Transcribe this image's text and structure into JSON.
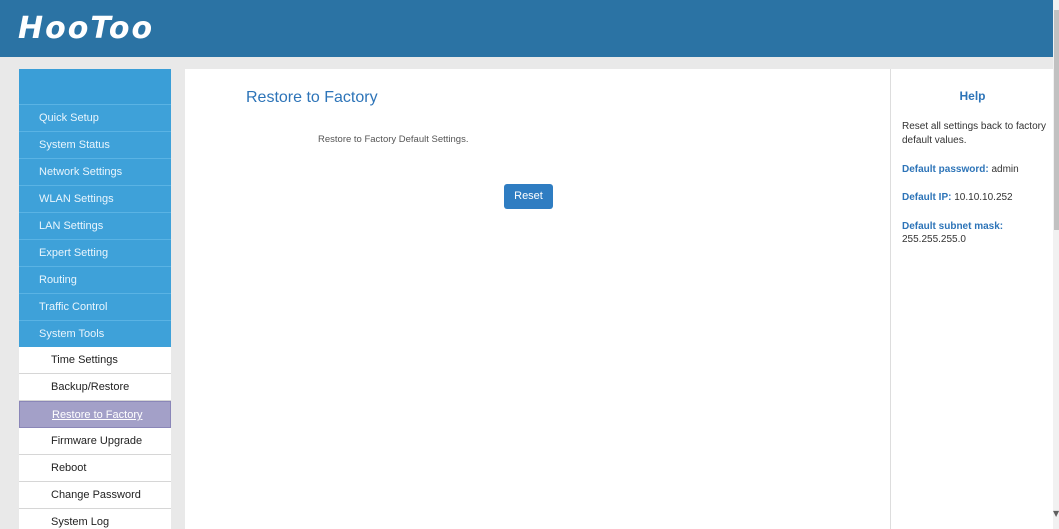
{
  "header": {
    "logo_text": "HooToo"
  },
  "sidebar": {
    "menu": [
      {
        "label": "Quick Setup"
      },
      {
        "label": "System Status"
      },
      {
        "label": "Network Settings"
      },
      {
        "label": "WLAN Settings"
      },
      {
        "label": "LAN Settings"
      },
      {
        "label": "Expert Setting"
      },
      {
        "label": "Routing"
      },
      {
        "label": "Traffic Control"
      },
      {
        "label": "System Tools"
      }
    ],
    "submenu": [
      {
        "label": "Time Settings"
      },
      {
        "label": "Backup/Restore"
      },
      {
        "label": "Restore to Factory",
        "active": true
      },
      {
        "label": "Firmware Upgrade"
      },
      {
        "label": "Reboot"
      },
      {
        "label": "Change Password"
      },
      {
        "label": "System Log"
      }
    ]
  },
  "main": {
    "title": "Restore to Factory",
    "description": "Restore to Factory Default Settings.",
    "reset_label": "Reset"
  },
  "help": {
    "title": "Help",
    "text": "Reset all settings back to factory default values.",
    "password_key": "Default password:",
    "password_value": "admin",
    "ip_key": "Default IP:",
    "ip_value": "10.10.10.252",
    "mask_key": "Default subnet mask:",
    "mask_value": "255.255.255.0"
  },
  "colors": {
    "header_bg": "#2b73a4",
    "menu_bg": "#3ea1d9",
    "active_item_bg": "#a3a0c8",
    "accent": "#2d74b8"
  }
}
